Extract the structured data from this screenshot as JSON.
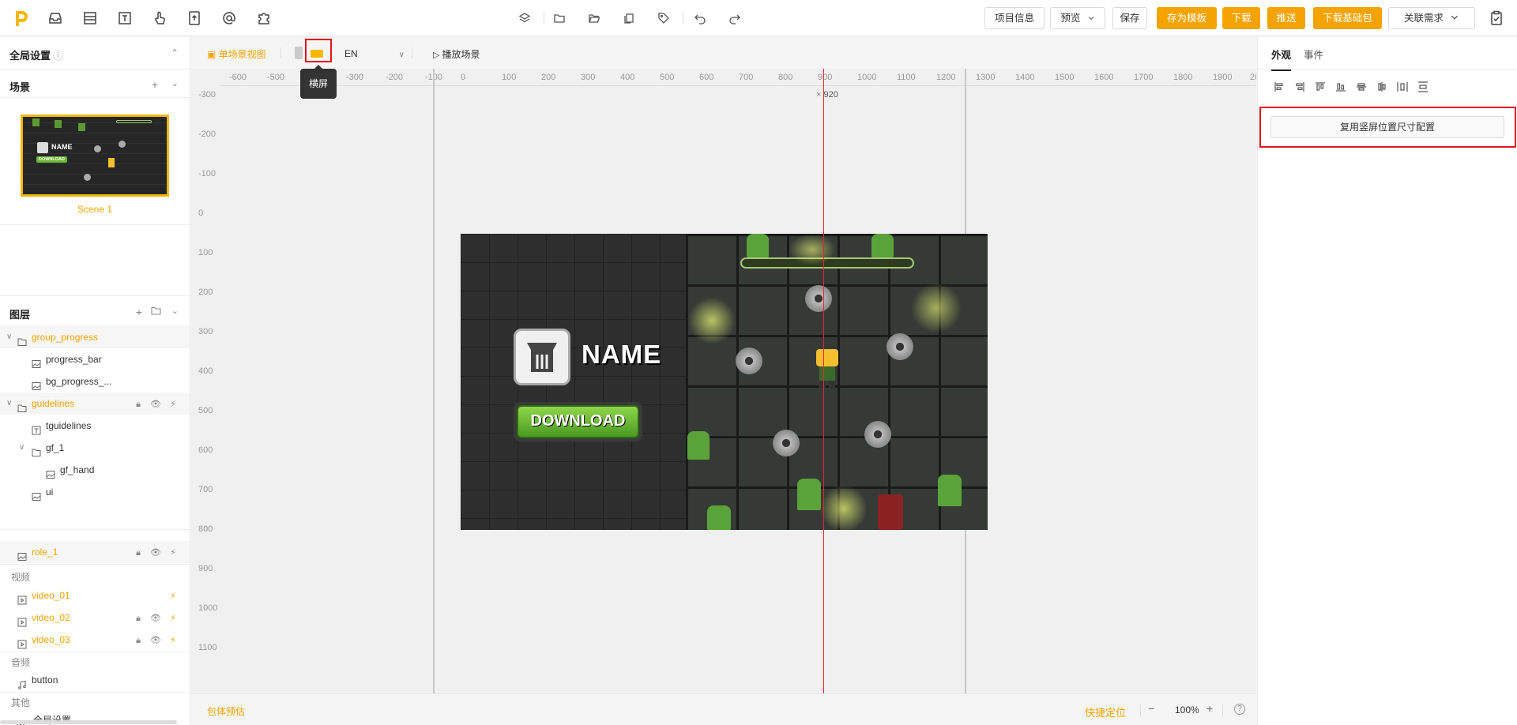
{
  "toolbar": {
    "left_icons": [
      "logo-icon",
      "inbox-icon",
      "layout-icon",
      "text-icon",
      "touch-icon",
      "upload-file-icon",
      "at-icon",
      "plugin-icon"
    ],
    "center_icons": [
      "layers-icon",
      "folder-icon",
      "folder-open-icon",
      "copy-icon",
      "tag-icon",
      "undo-icon",
      "redo-icon"
    ],
    "project_info": "项目信息",
    "preview": "预览",
    "save": "保存",
    "save_template": "存为模板",
    "download": "下载",
    "push": "推送",
    "download_base": "下载基础包",
    "link_demand": "关联需求"
  },
  "left": {
    "global_settings": "全局设置",
    "scene_title": "场景",
    "scene_name": "Scene 1",
    "thumb_name": "NAME",
    "thumb_download": "DOWNLOAD",
    "layers_title": "图层",
    "layers": [
      {
        "label": "group_progress",
        "type": "folder"
      },
      {
        "label": "progress_bar",
        "type": "image"
      },
      {
        "label": "bg_progress_...",
        "type": "image"
      },
      {
        "label": "guidelines",
        "type": "folder"
      },
      {
        "label": "tguidelines",
        "type": "text"
      },
      {
        "label": "gf_1",
        "type": "folder"
      },
      {
        "label": "gf_hand",
        "type": "image"
      },
      {
        "label": "ui",
        "type": "image"
      },
      {
        "label": "role_1",
        "type": "image"
      }
    ],
    "video_cat": "视频",
    "videos": [
      "video_01",
      "video_02",
      "video_03"
    ],
    "audio_cat": "音频",
    "audio": "button",
    "other_cat": "其他",
    "other": "全局设置"
  },
  "canvas": {
    "single_view": "单场景视图",
    "landscape_tooltip": "横屏",
    "language": "EN",
    "play_scene": "播放场景",
    "h_ticks": [
      "-400",
      "-600",
      "-500",
      "-400",
      "-300",
      "-200",
      "-100",
      "0",
      "100",
      "200",
      "300",
      "400",
      "500",
      "600",
      "700",
      "800",
      "900",
      "1000",
      "1100",
      "1200",
      "1300",
      "1400",
      "1500",
      "1600",
      "1700",
      "1800",
      "1900",
      "20"
    ],
    "v_ticks": [
      "-300",
      "-200",
      "-100",
      "0",
      "100",
      "200",
      "300",
      "400",
      "500",
      "600",
      "700",
      "800",
      "900",
      "1000",
      "1100"
    ],
    "cursor_x": "920",
    "game_name": "NAME",
    "game_download": "DOWNLOAD",
    "package_estimate": "包体预估",
    "quick_locate": "快捷定位",
    "zoom": "100%"
  },
  "right": {
    "tab_appearance": "外观",
    "tab_events": "事件",
    "reuse_button": "复用竖屏位置尺寸配置"
  },
  "colors": {
    "accent": "#f5a300",
    "highlight": "#e0141e"
  }
}
